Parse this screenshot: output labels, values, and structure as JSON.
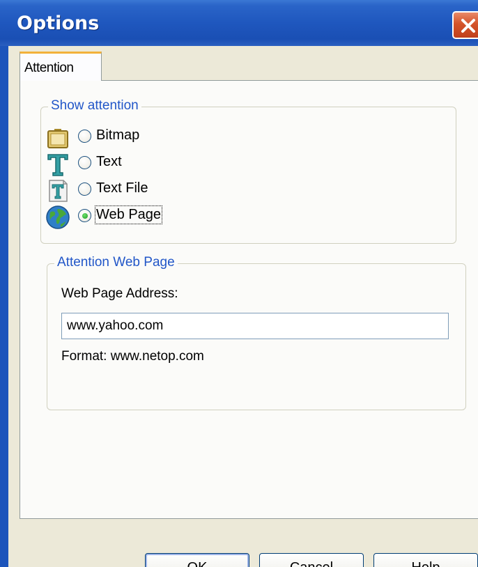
{
  "window": {
    "title": "Options",
    "close_icon": "close-icon",
    "colors": {
      "titlebar": "#1f57be",
      "close": "#d4532a",
      "client": "#ece9d8",
      "legend": "#2156c8",
      "tab_hot": "#f2b13a"
    }
  },
  "tabs": [
    {
      "label": "Attention",
      "selected": true
    }
  ],
  "show_attention": {
    "legend": "Show attention",
    "options": [
      {
        "label": "Bitmap",
        "icon": "bitmap-icon",
        "selected": false
      },
      {
        "label": "Text",
        "icon": "text-icon",
        "selected": false
      },
      {
        "label": "Text File",
        "icon": "text-file-icon",
        "selected": false
      },
      {
        "label": "Web Page",
        "icon": "globe-icon",
        "selected": true
      }
    ]
  },
  "attention_web_page": {
    "legend": "Attention Web Page",
    "address_label": "Web Page Address:",
    "address_value": "www.yahoo.com",
    "format_hint": "Format: www.netop.com"
  },
  "buttons": {
    "ok": "OK",
    "cancel": "Cancel",
    "help": "Help"
  }
}
